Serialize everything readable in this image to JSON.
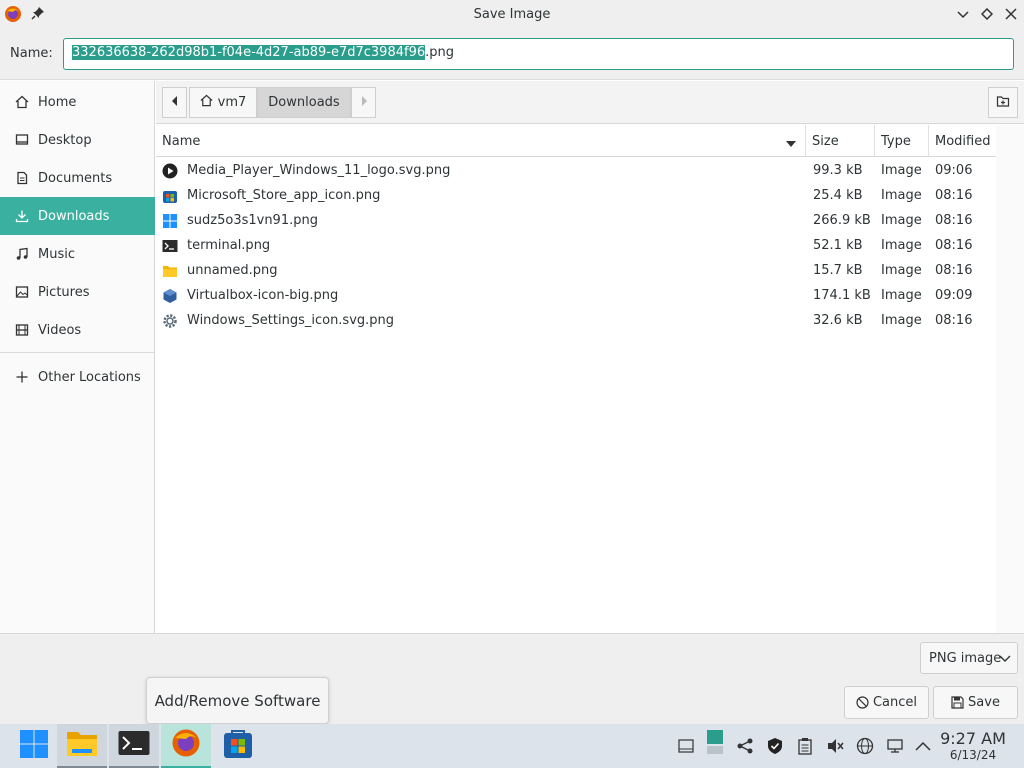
{
  "window": {
    "title": "Save Image"
  },
  "name_row": {
    "label": "Name:",
    "filename_selected": "332636638-262d98b1-f04e-4d27-ab89-e7d7c3984f96",
    "filename_ext": ".png"
  },
  "sidebar": {
    "items": [
      {
        "label": "Home",
        "icon": "home-icon"
      },
      {
        "label": "Desktop",
        "icon": "desktop-icon"
      },
      {
        "label": "Documents",
        "icon": "documents-icon"
      },
      {
        "label": "Downloads",
        "icon": "downloads-icon",
        "active": true
      },
      {
        "label": "Music",
        "icon": "music-icon"
      },
      {
        "label": "Pictures",
        "icon": "pictures-icon"
      },
      {
        "label": "Videos",
        "icon": "videos-icon"
      }
    ],
    "other": {
      "label": "Other Locations",
      "icon": "plus-icon"
    }
  },
  "pathbar": {
    "crumbs": [
      "vm7",
      "Downloads"
    ]
  },
  "table": {
    "headers": {
      "name": "Name",
      "size": "Size",
      "type": "Type",
      "modified": "Modified"
    },
    "rows": [
      {
        "name": "Media_Player_Windows_11_logo.svg.png",
        "size": "99.3 kB",
        "type": "Image",
        "modified": "09:06",
        "icon": "media-player-icon"
      },
      {
        "name": "Microsoft_Store_app_icon.png",
        "size": "25.4 kB",
        "type": "Image",
        "modified": "08:16",
        "icon": "store-icon"
      },
      {
        "name": "sudz5o3s1vn91.png",
        "size": "266.9 kB",
        "type": "Image",
        "modified": "08:16",
        "icon": "windows-logo-icon"
      },
      {
        "name": "terminal.png",
        "size": "52.1 kB",
        "type": "Image",
        "modified": "08:16",
        "icon": "terminal-icon"
      },
      {
        "name": "unnamed.png",
        "size": "15.7 kB",
        "type": "Image",
        "modified": "08:16",
        "icon": "folder-icon"
      },
      {
        "name": "Virtualbox-icon-big.png",
        "size": "174.1 kB",
        "type": "Image",
        "modified": "09:09",
        "icon": "virtualbox-icon"
      },
      {
        "name": "Windows_Settings_icon.svg.png",
        "size": "32.6 kB",
        "type": "Image",
        "modified": "08:16",
        "icon": "settings-gear-icon"
      }
    ]
  },
  "bottom": {
    "filetype": "PNG image",
    "cancel": "Cancel",
    "save": "Save"
  },
  "tooltip": {
    "text": "Add/Remove Software"
  },
  "taskbar": {
    "time": "9:27 AM",
    "date": "6/13/24"
  },
  "colors": {
    "accent": "#3ab1a0",
    "selection": "#2a9d8c"
  }
}
